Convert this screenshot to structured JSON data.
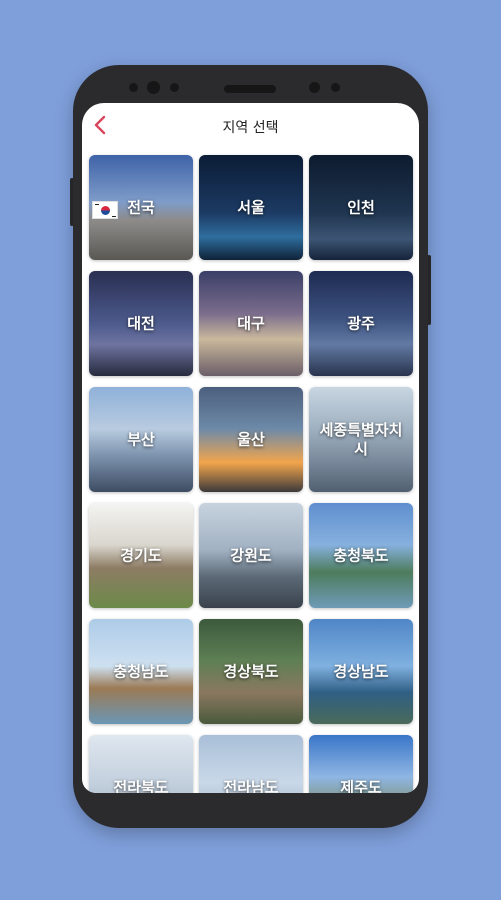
{
  "header": {
    "title": "지역 선택",
    "back_icon": "chevron-left-icon",
    "accent": "#d9465d"
  },
  "regions": [
    {
      "label": "전국"
    },
    {
      "label": "서울"
    },
    {
      "label": "인천"
    },
    {
      "label": "대전"
    },
    {
      "label": "대구"
    },
    {
      "label": "광주"
    },
    {
      "label": "부산"
    },
    {
      "label": "울산"
    },
    {
      "label": "세종특별자치시"
    },
    {
      "label": "경기도"
    },
    {
      "label": "강원도"
    },
    {
      "label": "충청북도"
    },
    {
      "label": "충청남도"
    },
    {
      "label": "경상북도"
    },
    {
      "label": "경상남도"
    },
    {
      "label": "전라북도"
    },
    {
      "label": "전라남도"
    },
    {
      "label": "제주도"
    }
  ]
}
